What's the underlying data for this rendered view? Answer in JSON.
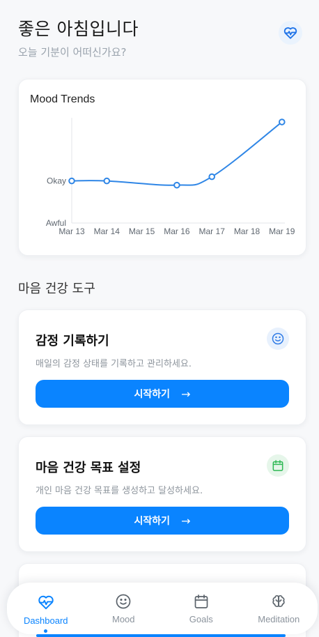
{
  "header": {
    "greeting": "좋은 아침입니다",
    "subtitle": "오늘 기분이 어떠신가요?",
    "heart_icon": "heart-pulse-icon"
  },
  "chart_data": {
    "type": "line",
    "title": "Mood Trends",
    "categories": [
      "Mar 13",
      "Mar 14",
      "Mar 15",
      "Mar 16",
      "Mar 17",
      "Mar 18",
      "Mar 19"
    ],
    "y_tick_labels": [
      "Awful",
      "Okay"
    ],
    "series": [
      {
        "x": [
          "Mar 13",
          "Mar 14",
          "Mar 16",
          "Mar 17",
          "Mar 19"
        ],
        "values": [
          2,
          2,
          1.8,
          2.2,
          4.8
        ]
      }
    ],
    "ylim": [
      0,
      5
    ],
    "grid": false,
    "color": "#2f86e6"
  },
  "tools": {
    "section_title": "마음 건강 도구",
    "items": [
      {
        "title": "감정 기록하기",
        "description": "매일의 감정 상태를 기록하고 관리하세요.",
        "button_label": "시작하기",
        "icon": "smile-icon",
        "icon_color": "#2f7be6"
      },
      {
        "title": "마음 건강 목표 설정",
        "description": "개인 마음 건강 목표를 생성하고 달성하세요.",
        "button_label": "시작하기",
        "icon": "calendar-icon",
        "icon_color": "#2fb955"
      }
    ]
  },
  "tab_bar": {
    "tabs": [
      {
        "label": "Dashboard",
        "icon": "heart-pulse-icon",
        "active": true
      },
      {
        "label": "Mood",
        "icon": "smile-icon",
        "active": false
      },
      {
        "label": "Goals",
        "icon": "calendar-icon",
        "active": false
      },
      {
        "label": "Meditation",
        "icon": "brain-icon",
        "active": false
      }
    ]
  },
  "colors": {
    "accent": "#0a84ff",
    "background": "#f7f8fa"
  }
}
